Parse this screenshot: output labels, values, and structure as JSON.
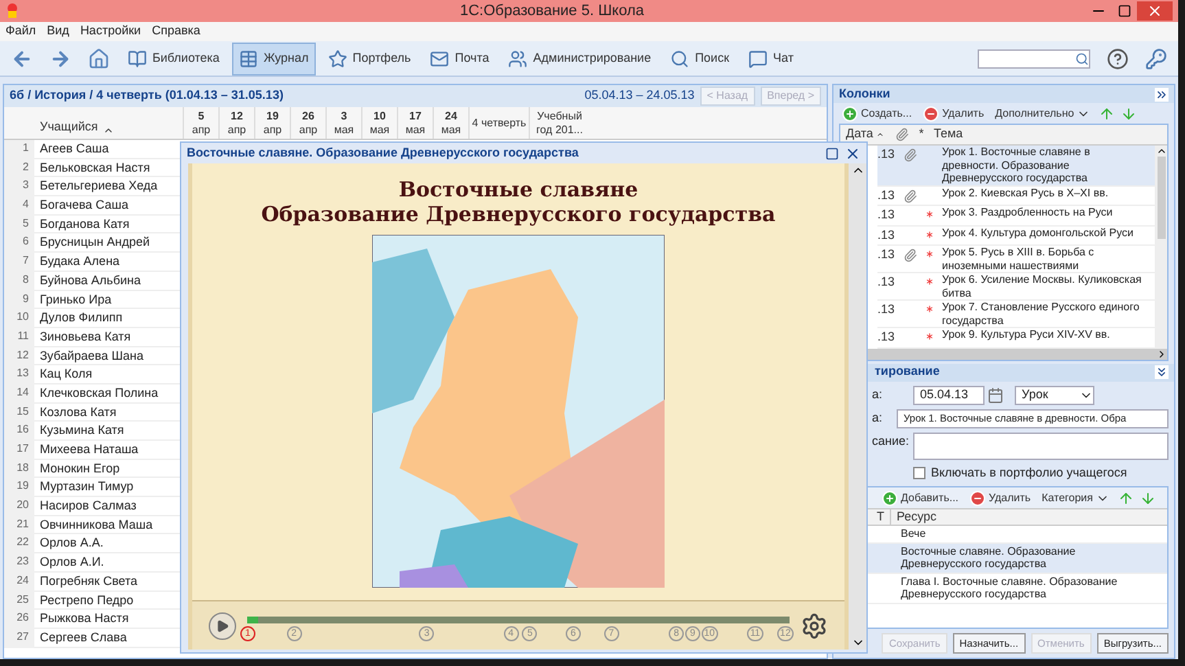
{
  "window": {
    "title": "1С:Образование 5. Школа"
  },
  "menu": [
    "Файл",
    "Вид",
    "Настройки",
    "Справка"
  ],
  "toolbar": {
    "items": [
      {
        "kind": "library",
        "label": "Библиотека",
        "selected": false
      },
      {
        "kind": "journal",
        "label": "Журнал",
        "selected": true
      },
      {
        "kind": "portfolio",
        "label": "Портфель",
        "selected": false
      },
      {
        "kind": "mail",
        "label": "Почта",
        "selected": false
      },
      {
        "kind": "admin",
        "label": "Администрирование",
        "selected": false
      },
      {
        "kind": "search",
        "label": "Поиск",
        "selected": false
      },
      {
        "kind": "chat",
        "label": "Чат",
        "selected": false
      }
    ]
  },
  "journal": {
    "breadcrumb": "6б / История / 4 четверть (01.04.13 – 31.05.13)",
    "date_range": "05.04.13 – 24.05.13",
    "prev_button": {
      "label": "< Назад",
      "disabled": true
    },
    "next_button": {
      "label": "Вперед >",
      "disabled": true
    },
    "name_column": "Учащийся",
    "columns": [
      {
        "lines": [
          "5",
          "апр"
        ]
      },
      {
        "lines": [
          "12",
          "апр"
        ]
      },
      {
        "lines": [
          "19",
          "апр"
        ]
      },
      {
        "lines": [
          "26",
          "апр"
        ]
      },
      {
        "lines": [
          "3",
          "мая"
        ]
      },
      {
        "lines": [
          "10",
          "мая"
        ]
      },
      {
        "lines": [
          "17",
          "мая"
        ]
      },
      {
        "lines": [
          "24",
          "мая"
        ]
      },
      {
        "lines": [
          "4 четверть"
        ]
      },
      {
        "lines": [
          "Учебный",
          "год 201..."
        ]
      }
    ],
    "students": [
      {
        "number": "1",
        "name": "Агеев Саша"
      },
      {
        "number": "2",
        "name": "Бельковская Настя"
      },
      {
        "number": "3",
        "name": "Бетельгериева Хеда"
      },
      {
        "number": "4",
        "name": "Богачева Саша"
      },
      {
        "number": "5",
        "name": "Богданова Катя"
      },
      {
        "number": "6",
        "name": "Брусницын Андрей"
      },
      {
        "number": "7",
        "name": "Будака Алена"
      },
      {
        "number": "8",
        "name": "Буйнова Альбина"
      },
      {
        "number": "9",
        "name": "Гринько Ира"
      },
      {
        "number": "10",
        "name": "Дулов Филипп"
      },
      {
        "number": "11",
        "name": "Зиновьева Катя"
      },
      {
        "number": "12",
        "name": "Зубайраева Шана"
      },
      {
        "number": "13",
        "name": "Кац Коля"
      },
      {
        "number": "14",
        "name": "Клечковская Полина"
      },
      {
        "number": "15",
        "name": "Козлова Катя"
      },
      {
        "number": "16",
        "name": "Кузьмина Катя"
      },
      {
        "number": "17",
        "name": "Михеева Наташа"
      },
      {
        "number": "18",
        "name": "Монокин Егор"
      },
      {
        "number": "19",
        "name": "Муртазин Тимур"
      },
      {
        "number": "20",
        "name": "Насиров Салмаз"
      },
      {
        "number": "21",
        "name": "Овчинникова Маша"
      },
      {
        "number": "22",
        "name": "Орлов А.А."
      },
      {
        "number": "23",
        "name": "Орлов А.И."
      },
      {
        "number": "24",
        "name": "Погребняк Света"
      },
      {
        "number": "25",
        "name": "Рестрепо Педро"
      },
      {
        "number": "26",
        "name": "Рыжкова Настя"
      },
      {
        "number": "27",
        "name": "Сергеев Слава"
      }
    ]
  },
  "viewer": {
    "title": "Восточные славяне. Образование Древнерусского государства",
    "heading": [
      "Восточные славяне",
      "Образование Древнерусского государства"
    ],
    "player": {
      "level": 0.02,
      "markers": [
        {
          "label": "1",
          "selected": true
        },
        {
          "label": "2",
          "selected": false
        },
        {
          "label": "3",
          "selected": false
        },
        {
          "label": "4",
          "selected": false
        },
        {
          "label": "5",
          "selected": false
        },
        {
          "label": "6",
          "selected": false
        },
        {
          "label": "7",
          "selected": false
        },
        {
          "label": "8",
          "selected": false
        },
        {
          "label": "9",
          "selected": false
        },
        {
          "label": "10",
          "selected": false
        },
        {
          "label": "11",
          "selected": false
        },
        {
          "label": "12",
          "selected": false
        }
      ]
    }
  },
  "columns_panel": {
    "title": "Колонки",
    "actions": [
      {
        "kind": "add",
        "label": "Создать..."
      },
      {
        "kind": "remove",
        "label": "Удалить"
      },
      {
        "kind": "menu",
        "label": "Дополнительно"
      }
    ],
    "headers": {
      "date": "Дата",
      "required": "*",
      "topic": "Тема"
    },
    "rows": [
      {
        "date": ".13",
        "attached": true,
        "required": false,
        "topic": "Урок 1. Восточные славяне в древности. Образование Древнерусского государства",
        "selected": true
      },
      {
        "date": ".13",
        "attached": true,
        "required": false,
        "topic": "Урок 2. Киевская Русь в X–XI вв.",
        "selected": false
      },
      {
        "date": ".13",
        "attached": false,
        "required": true,
        "topic": "Урок 3. Раздробленность на Руси",
        "selected": false
      },
      {
        "date": ".13",
        "attached": false,
        "required": true,
        "topic": "Урок 4. Культура домонгольской Руси",
        "selected": false
      },
      {
        "date": ".13",
        "attached": true,
        "required": true,
        "topic": "Урок 5. Русь в XIII в. Борьба с иноземными нашествиями",
        "selected": false
      },
      {
        "date": ".13",
        "attached": false,
        "required": true,
        "topic": "Урок 6. Усиление Москвы. Куликовская битва",
        "selected": false
      },
      {
        "date": ".13",
        "attached": false,
        "required": true,
        "topic": "Урок 7. Становление Русского единого государства",
        "selected": false
      },
      {
        "date": ".13",
        "attached": false,
        "required": true,
        "topic": "Урок 9. Культура Руси XIV-XV вв.",
        "selected": false
      }
    ]
  },
  "editing": {
    "title": "тирование",
    "date_label": "а:",
    "date": "05.04.13",
    "type": "Урок",
    "topic_label": "а:",
    "topic": "Урок 1. Восточные славяне в древности. Обра",
    "description_label": "сание:",
    "portfolio": {
      "label": "Включать в портфолио учащегося",
      "checked": false
    }
  },
  "resources": {
    "actions": [
      {
        "kind": "add",
        "label": "Добавить..."
      },
      {
        "kind": "remove",
        "label": "Удалить"
      },
      {
        "kind": "menu",
        "label": "Категория"
      }
    ],
    "headers": [
      "Т",
      "Ресурс"
    ],
    "rows": [
      {
        "title": "Вече",
        "selected": false
      },
      {
        "title": "Восточные славяне. Образование Древнерусского государства",
        "selected": true
      },
      {
        "title": "Глава I. Восточные славяне. Образование Древнерусского государства",
        "selected": false
      }
    ]
  },
  "buttons": [
    {
      "label": "Сохранить",
      "disabled": true
    },
    {
      "label": "Назначить...",
      "disabled": false
    },
    {
      "label": "Отменить",
      "disabled": true
    },
    {
      "label": "Выгрузить...",
      "disabled": false
    }
  ]
}
